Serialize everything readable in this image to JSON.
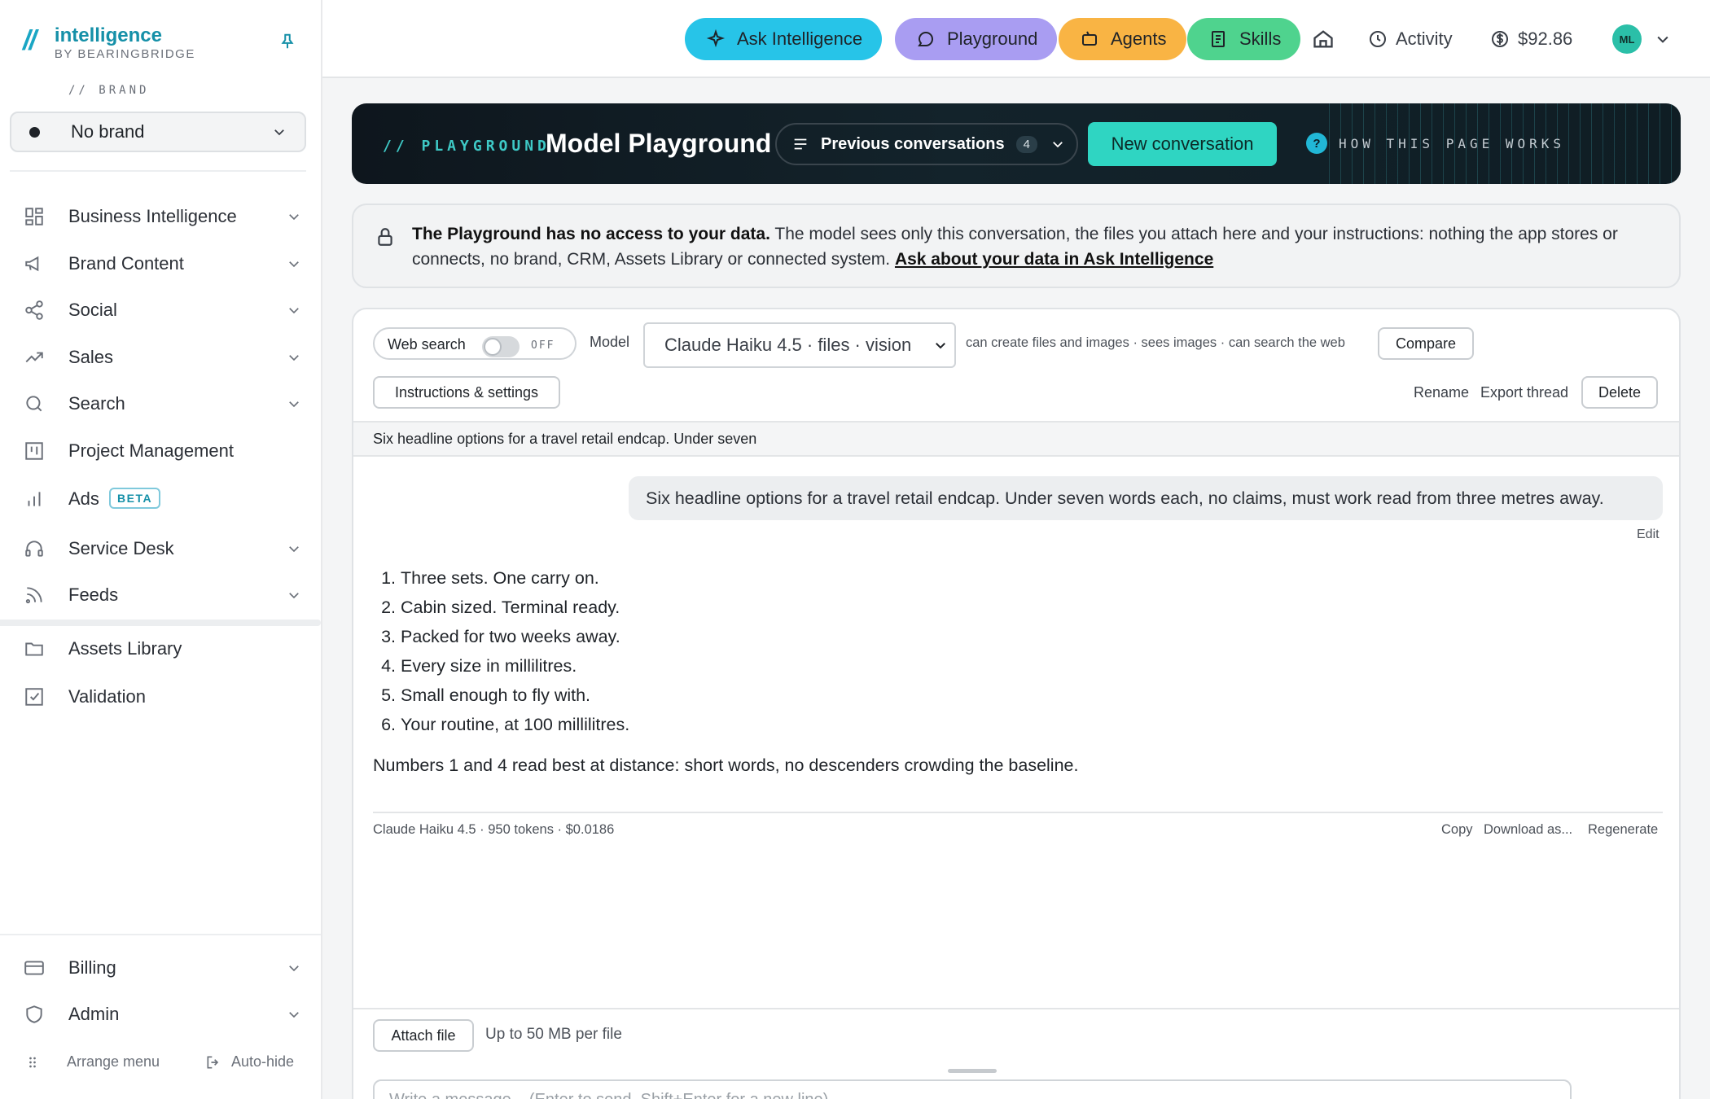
{
  "sidebar": {
    "logo_mark": "//",
    "logo_name": "intelligence",
    "logo_sub": "BY BEARINGBRIDGE",
    "brand_caption": "// BRAND",
    "brand_value": "No brand",
    "items": [
      {
        "label": "Business Intelligence",
        "icon": "grid-icon"
      },
      {
        "label": "Brand Content",
        "icon": "megaphone-icon"
      },
      {
        "label": "Social",
        "icon": "share-icon"
      },
      {
        "label": "Sales",
        "icon": "trend-icon"
      },
      {
        "label": "Search",
        "icon": "search-icon"
      },
      {
        "label": "Project Management",
        "icon": "kanban-icon"
      },
      {
        "label": "Ads",
        "icon": "bar-chart-icon",
        "badge": "BETA"
      },
      {
        "label": "Service Desk",
        "icon": "headset-icon"
      },
      {
        "label": "Feeds",
        "icon": "rss-icon"
      },
      {
        "label": "Assets Library",
        "icon": "folder-icon"
      },
      {
        "label": "Validation",
        "icon": "checkbox-icon"
      },
      {
        "label": "Billing",
        "icon": "card-icon"
      },
      {
        "label": "Admin",
        "icon": "shield-icon"
      }
    ],
    "arrange_menu": "Arrange menu",
    "auto_hide": "Auto-hide"
  },
  "topbar": {
    "ask": "Ask Intelligence",
    "playground": "Playground",
    "agents": "Agents",
    "skills": "Skills",
    "activity": "Activity",
    "balance": "$92.86",
    "avatar": "ML",
    "colors": {
      "ask": "#27c4e8",
      "playground": "#a99df2",
      "agents": "#f9b444",
      "skills": "#4fd38e"
    }
  },
  "hero": {
    "tag": "// PLAYGROUND",
    "title": "Model Playground",
    "prev_label": "Previous conversations",
    "prev_count": "4",
    "new_label": "New conversation",
    "help_q": "?",
    "help_label": "HOW THIS PAGE WORKS"
  },
  "notice": {
    "bold": "The Playground has no access to your data.",
    "text": " The model sees only this conversation, the files you attach here and your instructions: nothing the app stores or connects, no brand, CRM, Assets Library or connected system. ",
    "link": "Ask about your data in Ask Intelligence"
  },
  "controls": {
    "web_search": "Web search",
    "web_search_state": "OFF",
    "model_label": "Model",
    "model_value": "Claude Haiku 4.5 · files · vision",
    "capabilities": "can create files and images · sees images · can search the web",
    "compare": "Compare",
    "instructions": "Instructions & settings",
    "rename": "Rename",
    "export": "Export thread",
    "delete": "Delete"
  },
  "thread": {
    "title": "Six headline options for a travel retail endcap. Under seven",
    "user_message": "Six headline options for a travel retail endcap. Under seven words each, no claims, must work read from three metres away.",
    "edit": "Edit",
    "answer_items": [
      "Three sets. One carry on.",
      "Cabin sized. Terminal ready.",
      "Packed for two weeks away.",
      "Every size in millilitres.",
      "Small enough to fly with.",
      "Your routine, at 100 millilitres."
    ],
    "answer_note": "Numbers 1 and 4 read best at distance: short words, no descenders crowding the baseline.",
    "meta": "Claude Haiku 4.5 · 950 tokens · $0.0186",
    "copy": "Copy",
    "download": "Download as...",
    "regenerate": "Regenerate"
  },
  "composer": {
    "attach": "Attach file",
    "attach_note": "Up to 50 MB per file",
    "placeholder": "Write a message... (Enter to send, Shift+Enter for a new line)"
  }
}
